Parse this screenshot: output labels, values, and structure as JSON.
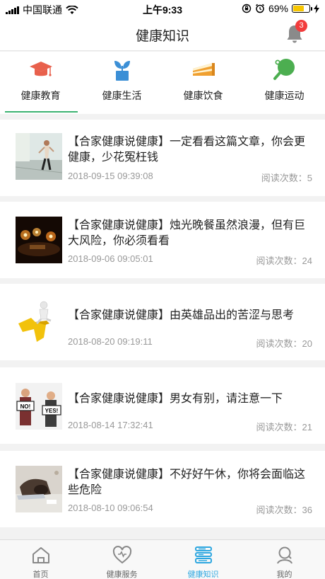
{
  "status_bar": {
    "carrier": "中国联通",
    "time": "上午9:33",
    "battery": "69%",
    "battery_level": 0.69
  },
  "header": {
    "title": "健康知识",
    "notification_count": "3"
  },
  "categories": [
    {
      "label": "健康教育",
      "icon": "graduation-cap-icon",
      "color": "#e8604c",
      "active": true
    },
    {
      "label": "健康生活",
      "icon": "plant-icon",
      "color": "#3b8fd6",
      "active": false
    },
    {
      "label": "健康饮食",
      "icon": "cake-icon",
      "color": "#f0a030",
      "active": false
    },
    {
      "label": "健康运动",
      "icon": "ping-pong-icon",
      "color": "#4cae50",
      "active": false
    }
  ],
  "articles": [
    {
      "title": "【合家健康说健康】一定看看这篇文章，你会更健康，少花冤枉钱",
      "date": "2018-09-15 09:39:08",
      "reads": "阅读次数：5"
    },
    {
      "title": "【合家健康说健康】烛光晚餐虽然浪漫，但有巨大风险，你必须看看",
      "date": "2018-09-06 09:05:01",
      "reads": "阅读次数：24"
    },
    {
      "title": "【合家健康说健康】由英雄品出的苦涩与思考",
      "date": "2018-08-20 09:19:11",
      "reads": "阅读次数：20"
    },
    {
      "title": "【合家健康说健康】男女有别，请注意一下",
      "date": "2018-08-14 17:32:41",
      "reads": "阅读次数：21",
      "thumb_text": [
        "NO!",
        "YES!"
      ]
    },
    {
      "title": "【合家健康说健康】不好好午休，你将会面临这些危险",
      "date": "2018-08-10 09:06:54",
      "reads": "阅读次数：36"
    }
  ],
  "tabs": [
    {
      "label": "首页",
      "icon": "home-icon",
      "active": false
    },
    {
      "label": "健康服务",
      "icon": "heart-icon",
      "active": false
    },
    {
      "label": "健康知识",
      "icon": "book-icon",
      "active": true
    },
    {
      "label": "我的",
      "icon": "user-icon",
      "active": false
    }
  ],
  "colors": {
    "accent": "#2ea7e0",
    "underline": "#3cb371",
    "badge": "#f23c3c"
  }
}
